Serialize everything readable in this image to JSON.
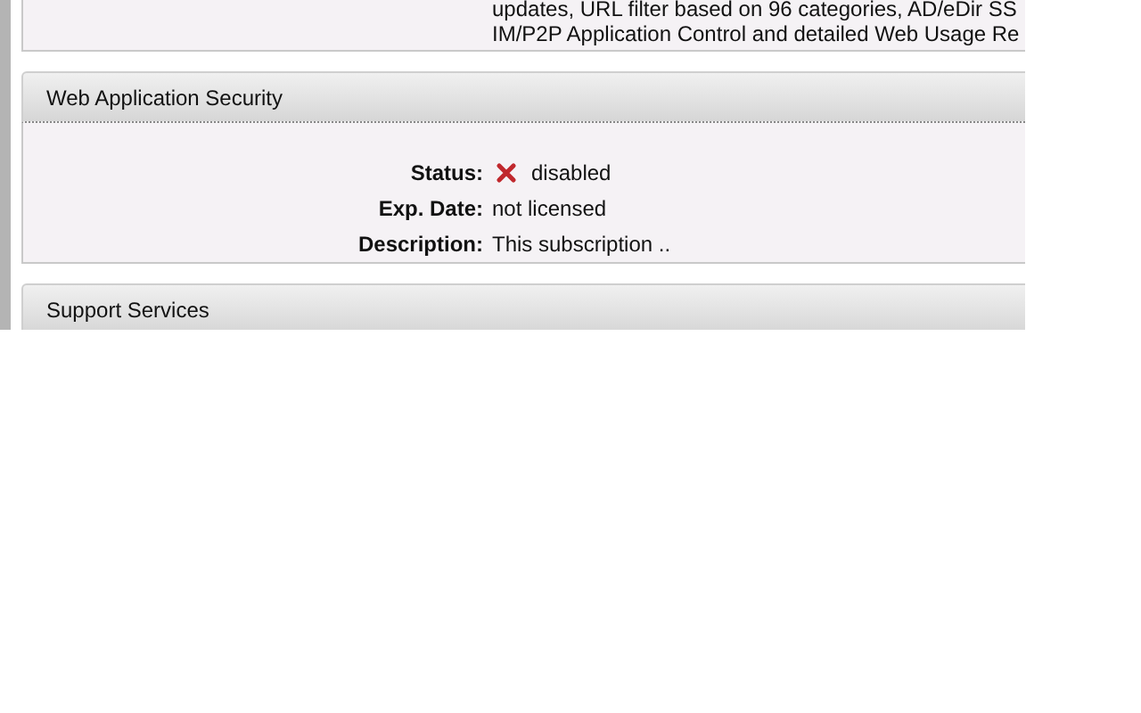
{
  "previous_section": {
    "description_lines": [
      "updates, URL filter based on 96 categories, AD/eDir SS",
      "IM/P2P Application Control and detailed Web Usage Re"
    ]
  },
  "sections": [
    {
      "title": "Web Application Security",
      "fields": [
        {
          "kind": "status",
          "label": "Status:",
          "value": "disabled"
        },
        {
          "kind": "text",
          "label": "Exp. Date:",
          "value": "not licensed"
        },
        {
          "kind": "text",
          "label": "Description:",
          "value": "This subscription .."
        }
      ]
    },
    {
      "title": "Support Services"
    }
  ]
}
